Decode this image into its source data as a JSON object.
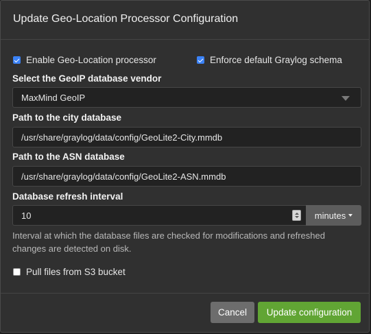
{
  "modal": {
    "title": "Update Geo-Location Processor Configuration"
  },
  "options": {
    "enable_processor": {
      "label": "Enable Geo-Location processor",
      "checked": true
    },
    "enforce_schema": {
      "label": "Enforce default Graylog schema",
      "checked": true
    },
    "pull_s3": {
      "label": "Pull files from S3 bucket",
      "checked": false
    }
  },
  "vendor": {
    "label": "Select the GeoIP database vendor",
    "selected": "MaxMind GeoIP"
  },
  "city_db": {
    "label": "Path to the city database",
    "value": "/usr/share/graylog/data/config/GeoLite2-City.mmdb"
  },
  "asn_db": {
    "label": "Path to the ASN database",
    "value": "/usr/share/graylog/data/config/GeoLite2-ASN.mmdb"
  },
  "refresh": {
    "label": "Database refresh interval",
    "value": "10",
    "unit": "minutes",
    "help": "Interval at which the database files are checked for modifications and refreshed changes are detected on disk."
  },
  "footer": {
    "cancel_label": "Cancel",
    "submit_label": "Update configuration"
  },
  "colors": {
    "accent_checkbox": "#3b82f6",
    "submit_green": "#61a534",
    "cancel_gray": "#6d6d6d"
  }
}
